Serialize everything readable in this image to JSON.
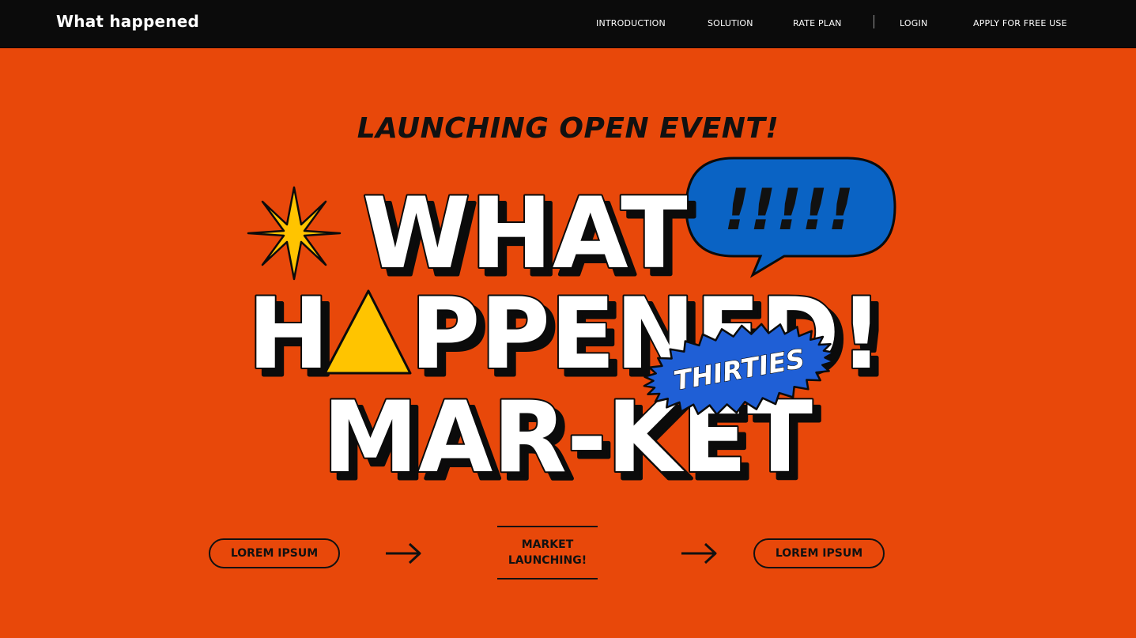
{
  "header": {
    "brand": "What happened",
    "nav": {
      "introduction": "INTRODUCTION",
      "solution": "SOLUTION",
      "rate_plan": "RATE PLAN",
      "login": "LOGIN",
      "apply": "APPLY FOR FREE USE"
    }
  },
  "hero": {
    "eyebrow": "LAUNCHING OPEN EVENT!",
    "line1": "WHAT",
    "line2_h": "H",
    "line2_rest": "PPENED!",
    "line3": "MAR-KET",
    "bubble_text": "!!!!!",
    "badge_text": "THIRTIES"
  },
  "flow": {
    "left_button": "LOREM IPSUM",
    "center_line1": "MARKET",
    "center_line2": "LAUNCHING!",
    "right_button": "LOREM IPSUM"
  },
  "colors": {
    "background": "#E8480A",
    "topbar": "#0b0b0b",
    "bubble": "#0A63C4",
    "badge": "#1F5FD6",
    "accent_yellow": "#FFC400"
  },
  "icons": [
    "sparkle-star-icon",
    "triangle-letter-a-icon",
    "speech-bubble-icon",
    "arrow-right-icon"
  ]
}
